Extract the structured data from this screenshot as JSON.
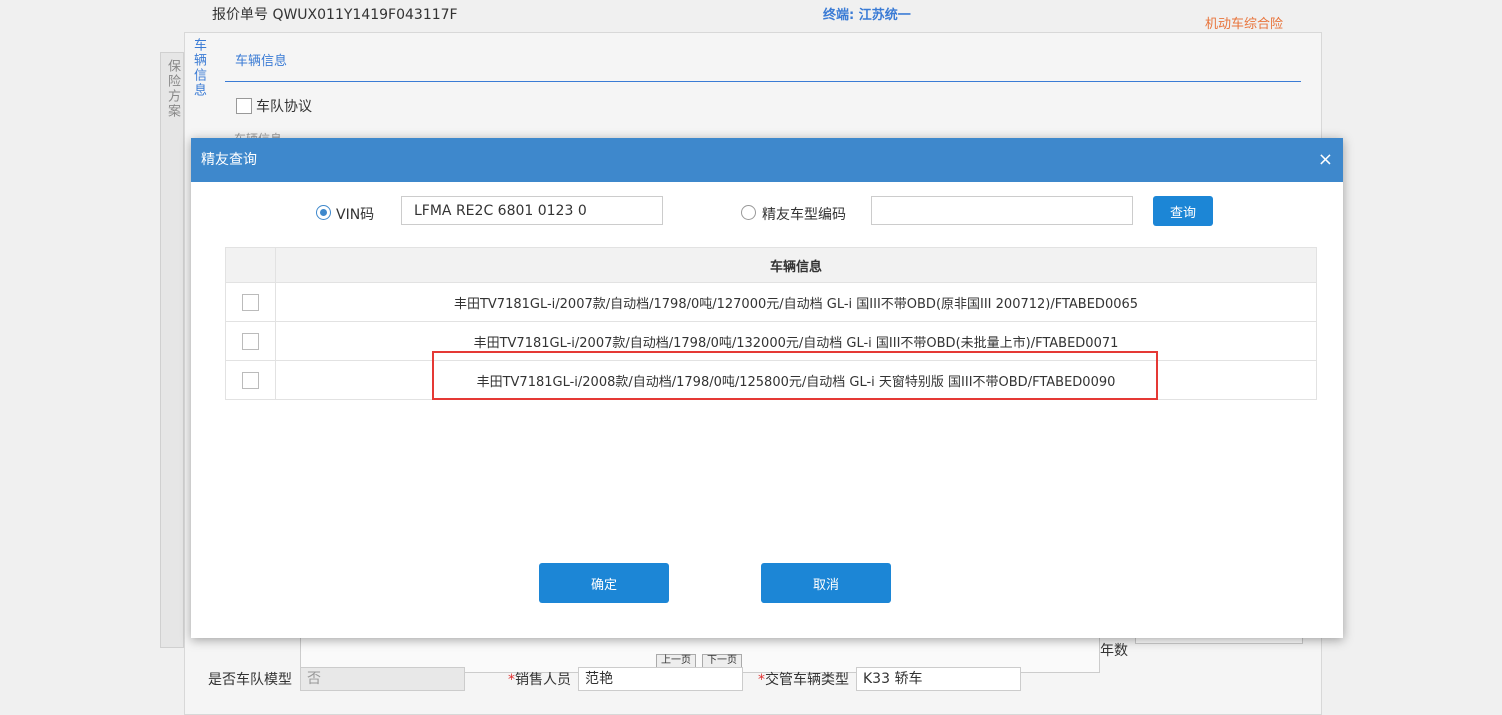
{
  "header": {
    "quote_label": "报价单号 QWUX011Y1419F043117F",
    "terminal": "终端: 江苏统一",
    "insurance_type": "机动车综合险"
  },
  "sidebar": {
    "tab_plan": "保险方案",
    "tab_vehicle": "车辆信息"
  },
  "section": {
    "title": "车辆信息",
    "fleet_agreement": "车队协议",
    "peek_text": "车辆信息"
  },
  "pager": {
    "prev": "上一页",
    "next": "下一页"
  },
  "bottom": {
    "years_label": "年数",
    "fleet_model_label": "是否车队模型",
    "fleet_model_value": "否",
    "sales_label": "销售人员",
    "sales_value": "范艳",
    "vehicle_type_label": "交管车辆类型",
    "vehicle_type_value": "K33 轿车"
  },
  "modal": {
    "title": "精友查询",
    "close": "×",
    "vin_label": "VIN码",
    "vin_value": "LFMA RE2C 6801 0123 0",
    "model_code_label": "精友车型编码",
    "model_code_value": "",
    "query_button": "查询",
    "table_header": "车辆信息",
    "rows": [
      "丰田TV7181GL-i/2007款/自动档/1798/0吨/127000元/自动档 GL-i 国III不带OBD(原非国III 200712)/FTABED0065",
      "丰田TV7181GL-i/2007款/自动档/1798/0吨/132000元/自动档 GL-i 国III不带OBD(未批量上市)/FTABED0071",
      "丰田TV7181GL-i/2008款/自动档/1798/0吨/125800元/自动档 GL-i 天窗特别版 国III不带OBD/FTABED0090"
    ],
    "confirm_button": "确定",
    "cancel_button": "取消"
  },
  "colors": {
    "primary": "#1c86d6",
    "header_bar": "#3e88cc",
    "highlight": "#e53935",
    "accent_orange": "#e8743b"
  }
}
